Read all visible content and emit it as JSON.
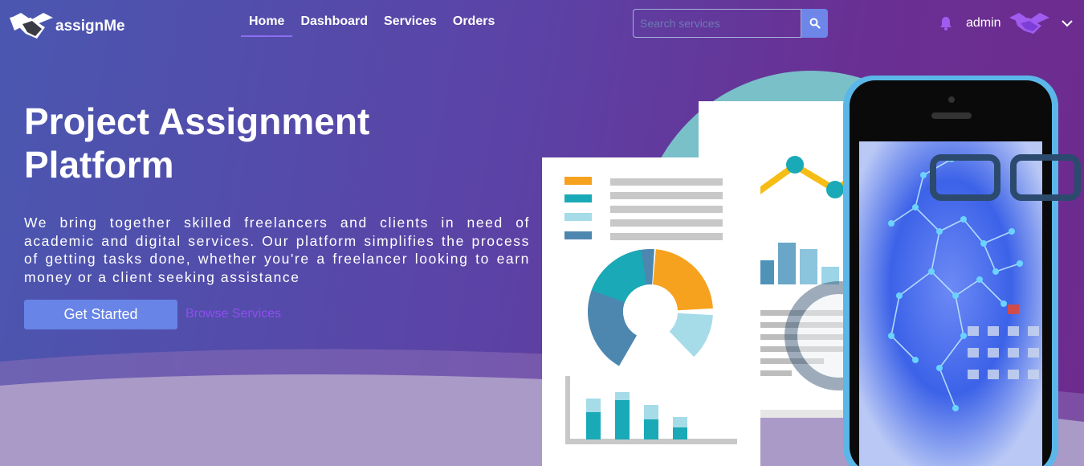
{
  "brand": {
    "name": "assignMe",
    "icon": "handshake-icon"
  },
  "nav": {
    "items": [
      {
        "label": "Home",
        "active": true
      },
      {
        "label": "Dashboard",
        "active": false
      },
      {
        "label": "Services",
        "active": false
      },
      {
        "label": "Orders",
        "active": false
      }
    ]
  },
  "search": {
    "placeholder": "Search services",
    "value": "",
    "icon": "search-icon"
  },
  "user": {
    "name": "admin",
    "bell_icon": "bell-icon",
    "avatar_icon": "handshake-icon",
    "menu_icon": "chevron-down-icon"
  },
  "hero": {
    "title": "Project Assignment Platform",
    "description": "We bring together skilled freelancers and clients in need of academic and digital services. Our platform simplifies the process of getting tasks done, whether you're a freelancer looking to earn money or a client seeking assistance",
    "primary_button": "Get Started",
    "secondary_link": "Browse Services"
  },
  "colors": {
    "accent": "#6784e6",
    "link": "#8e4ff0",
    "bell": "#a05cf0",
    "teal": "#19a9b7",
    "orange": "#f6a21e"
  }
}
